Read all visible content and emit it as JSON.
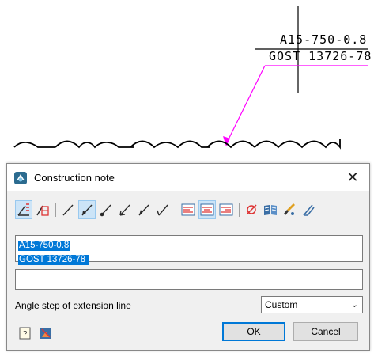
{
  "drawing": {
    "note_line1": "A15-750-0.8",
    "note_line2": "GOST 13726-78",
    "leader_color": "#ff00ff"
  },
  "dialog": {
    "title": "Construction note",
    "close_glyph": "✕",
    "toolbar": {
      "icons": [
        "note-settings-icon",
        "note-table-icon",
        "line-leader-icon",
        "arrow-leader-icon",
        "dot-leader-icon",
        "open-arrow-leader-icon",
        "half-arrow-leader-icon",
        "tick-leader-icon",
        "align-left-icon",
        "align-center-icon",
        "align-right-icon",
        "diameter-symbol-icon",
        "library-book-icon",
        "paint-brush-icon",
        "magic-pen-icon"
      ],
      "active": [
        "note-settings-icon",
        "arrow-leader-icon",
        "align-center-icon"
      ]
    },
    "text_lines": [
      "A15-750-0.8",
      "GOST 13726-78 "
    ],
    "second_field_value": "",
    "angle_label": "Angle step of extension line",
    "angle_value": "Custom",
    "ok_label": "OK",
    "cancel_label": "Cancel",
    "accent_color": "#0078d7",
    "selection_color": "#0078d7"
  }
}
